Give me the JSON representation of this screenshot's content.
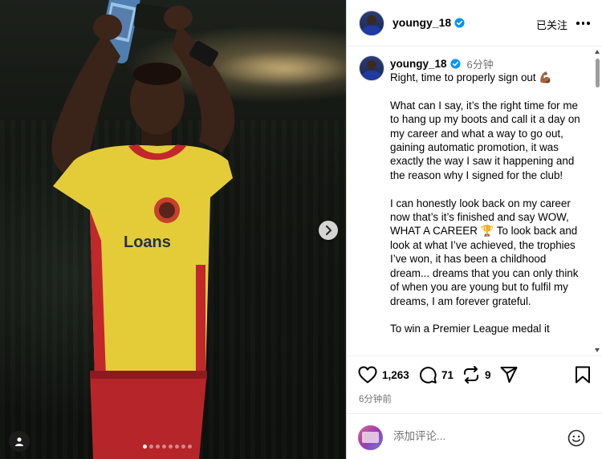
{
  "post": {
    "username": "youngy_18",
    "follow_status": "已关注",
    "caption_time": "6分钟",
    "caption": "Right, time to properly sign out 💪🏾\n\nWhat can I say, it’s the right time for me to hang up my boots and call it a day on my career and what a way to go out, gaining automatic promotion, it was exactly the way I saw it happening and the reason why I signed for the club!\n\nI can honestly look back on my career now that’s it’s finished and say WOW, WHAT A CAREER 🏆 To look back and look at what I’ve achieved, the trophies I’ve won, it has been a childhood dream... dreams that you can only think of when you are young but to fulfil my dreams, I am forever grateful.\n\nTo win a Premier League medal it",
    "likes": "1,263",
    "comments_count": "71",
    "reposts": "9",
    "posted_time": "6分钟前"
  },
  "media": {
    "shirt_sponsor": "Loans",
    "carousel_count": 8,
    "carousel_active": 0
  },
  "comment_box": {
    "placeholder": "添加评论..."
  },
  "icons": {
    "verified": "verified-badge-icon",
    "more": "more-options-icon",
    "like": "heart-icon",
    "comment": "comment-bubble-icon",
    "repost": "repost-icon",
    "share": "paper-plane-icon",
    "save": "bookmark-icon",
    "emoji": "emoji-icon",
    "next": "chevron-right-icon",
    "user_tag": "user-tag-icon"
  },
  "colors": {
    "verified_blue": "#0095f6",
    "muted_text": "#737373",
    "shirt_yellow": "#e8d33a",
    "shirt_red": "#c8272b"
  }
}
